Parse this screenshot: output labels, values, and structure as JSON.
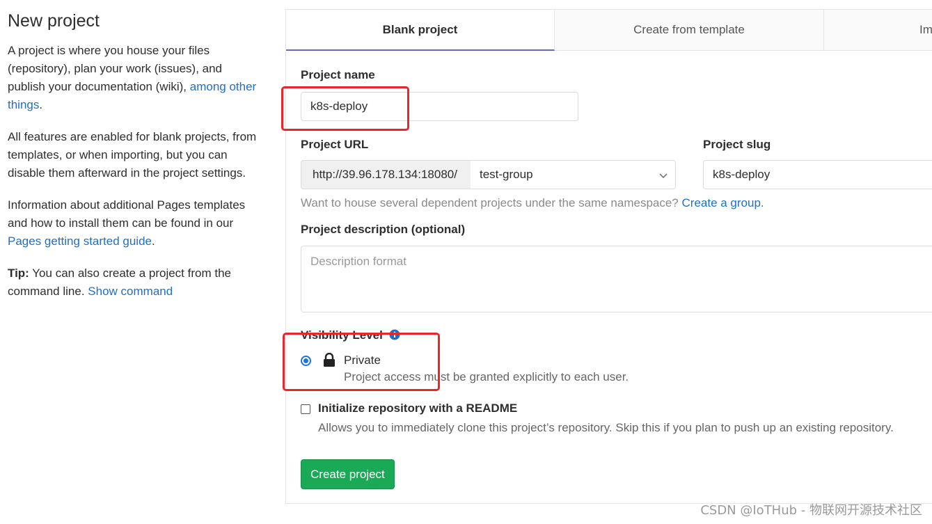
{
  "left": {
    "title": "New project",
    "intro_text": "A project is where you house your files (repository), plan your work (issues), and publish your documentation (wiki),",
    "intro_link": "among other things",
    "intro_end": ".",
    "features_text": "All features are enabled for blank projects, from templates, or when importing, but you can disable them afterward in the project settings.",
    "pages_text": "Information about additional Pages templates and how to install them can be found in our",
    "pages_link": "Pages getting started guide",
    "pages_end": ".",
    "tip_label": "Tip:",
    "tip_text": "You can also create a project from the command line.",
    "tip_link": "Show command"
  },
  "tabs": [
    {
      "label": "Blank project",
      "active": true
    },
    {
      "label": "Create from template",
      "active": false
    },
    {
      "label": "Im",
      "active": false
    }
  ],
  "form": {
    "project_name_label": "Project name",
    "project_name_value": "k8s-deploy",
    "project_url_label": "Project URL",
    "url_prefix": "http://39.96.178.134:18080/",
    "namespace_value": "test-group",
    "project_slug_label": "Project slug",
    "project_slug_value": "k8s-deploy",
    "namespace_help": "Want to house several dependent projects under the same namespace?",
    "namespace_help_link": "Create a group.",
    "description_label": "Project description (optional)",
    "description_placeholder": "Description format",
    "visibility_label": "Visibility Level",
    "visibility_option": "Private",
    "visibility_desc": "Project access must be granted explicitly to each user.",
    "readme_label": "Initialize repository with a README",
    "readme_desc": "Allows you to immediately clone this project’s repository. Skip this if you plan to push up an existing repository.",
    "create_button": "Create project"
  },
  "watermark": "CSDN @IoTHub - 物联网开源技术社区",
  "colors": {
    "link": "#1f6fc5",
    "primary_button": "#1aaa55",
    "active_tab_underline": "#6666c4",
    "annotation_red": "#e8262b"
  }
}
